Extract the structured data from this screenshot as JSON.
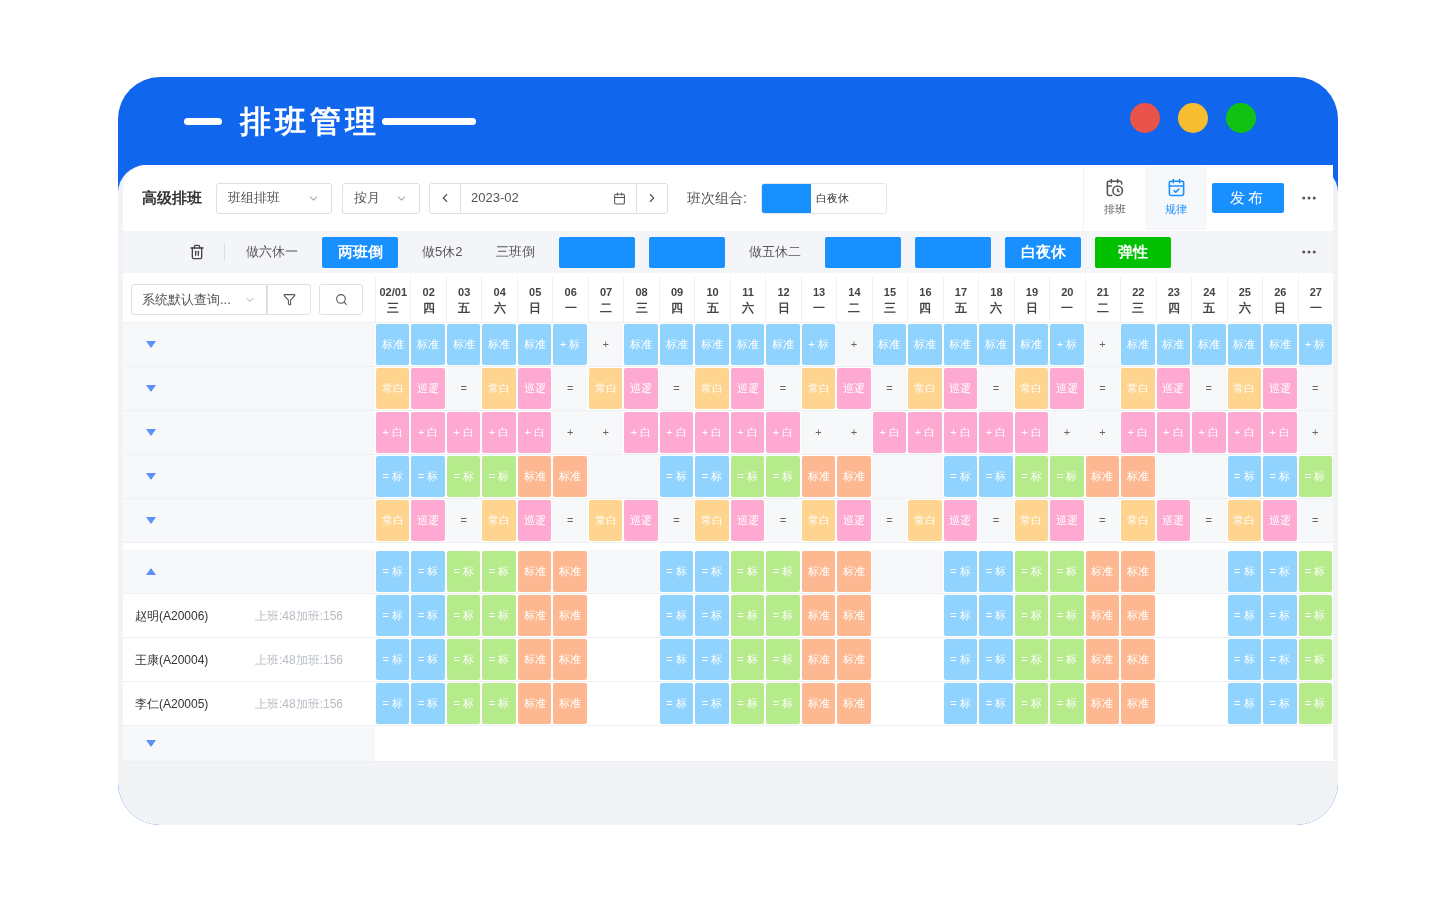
{
  "header": {
    "title": "排班管理",
    "dots": [
      {
        "color": "#e8534a"
      },
      {
        "color": "#f6bd31"
      },
      {
        "color": "#12c212"
      }
    ]
  },
  "toolbar": {
    "title": "高级排班",
    "group_select": "班组排班",
    "period_select": "按月",
    "date": "2023-02",
    "combo_label": "班次组合:",
    "combo_value": "白夜休",
    "actions": [
      {
        "label": "排班",
        "selected": false
      },
      {
        "label": "规律",
        "selected": true
      }
    ],
    "publish": "发布"
  },
  "patterns": [
    {
      "kind": "plain",
      "label": "做六休一"
    },
    {
      "kind": "filled",
      "label": "两班倒",
      "color": "#1890ff"
    },
    {
      "kind": "plain",
      "label": "做5休2"
    },
    {
      "kind": "plain",
      "label": "三班倒"
    },
    {
      "kind": "filled",
      "color": "#1890ff"
    },
    {
      "kind": "filled",
      "color": "#1890ff"
    },
    {
      "kind": "plain",
      "label": "做五休二"
    },
    {
      "kind": "filled",
      "color": "#1890ff"
    },
    {
      "kind": "filled",
      "color": "#1890ff"
    },
    {
      "kind": "filled",
      "label": "白夜休",
      "color": "#1890ff"
    },
    {
      "kind": "filled",
      "label": "弹性",
      "color": "#00c000"
    }
  ],
  "grid": {
    "query_select": "系统默认查询...",
    "days": [
      {
        "date": "02/01",
        "weekday": "三"
      },
      {
        "date": "02",
        "weekday": "四"
      },
      {
        "date": "03",
        "weekday": "五"
      },
      {
        "date": "04",
        "weekday": "六"
      },
      {
        "date": "05",
        "weekday": "日"
      },
      {
        "date": "06",
        "weekday": "一"
      },
      {
        "date": "07",
        "weekday": "二"
      },
      {
        "date": "08",
        "weekday": "三"
      },
      {
        "date": "09",
        "weekday": "四"
      },
      {
        "date": "10",
        "weekday": "五"
      },
      {
        "date": "11",
        "weekday": "六"
      },
      {
        "date": "12",
        "weekday": "日"
      },
      {
        "date": "13",
        "weekday": "一"
      },
      {
        "date": "14",
        "weekday": "二"
      },
      {
        "date": "15",
        "weekday": "三"
      },
      {
        "date": "16",
        "weekday": "四"
      },
      {
        "date": "17",
        "weekday": "五"
      },
      {
        "date": "18",
        "weekday": "六"
      },
      {
        "date": "19",
        "weekday": "日"
      },
      {
        "date": "20",
        "weekday": "一"
      },
      {
        "date": "21",
        "weekday": "二"
      },
      {
        "date": "22",
        "weekday": "三"
      },
      {
        "date": "23",
        "weekday": "四"
      },
      {
        "date": "24",
        "weekday": "五"
      },
      {
        "date": "25",
        "weekday": "六"
      },
      {
        "date": "26",
        "weekday": "日"
      },
      {
        "date": "27",
        "weekday": "一"
      }
    ],
    "rows": [
      {
        "kind": "group",
        "expanded": false,
        "cells": [
          {
            "color": "#8fd3fe",
            "text": "标准"
          },
          {
            "color": "#8fd3fe",
            "text": "标准"
          },
          {
            "color": "#8fd3fe",
            "text": "标准"
          },
          {
            "color": "#8fd3fe",
            "text": "标准"
          },
          {
            "color": "#8fd3fe",
            "text": "标准"
          },
          {
            "color": "#8fd3fe",
            "text": "+ 标"
          },
          {
            "text": "+"
          },
          {
            "color": "#8fd3fe",
            "text": "标准"
          },
          {
            "color": "#8fd3fe",
            "text": "标准"
          },
          {
            "color": "#8fd3fe",
            "text": "标准"
          },
          {
            "color": "#8fd3fe",
            "text": "标准"
          },
          {
            "color": "#8fd3fe",
            "text": "标准"
          },
          {
            "color": "#8fd3fe",
            "text": "+ 标"
          },
          {
            "text": "+"
          },
          {
            "color": "#8fd3fe",
            "text": "标准"
          },
          {
            "color": "#8fd3fe",
            "text": "标准"
          },
          {
            "color": "#8fd3fe",
            "text": "标准"
          },
          {
            "color": "#8fd3fe",
            "text": "标准"
          },
          {
            "color": "#8fd3fe",
            "text": "标准"
          },
          {
            "color": "#8fd3fe",
            "text": "+ 标"
          },
          {
            "text": "+"
          },
          {
            "color": "#8fd3fe",
            "text": "标准"
          },
          {
            "color": "#8fd3fe",
            "text": "标准"
          },
          {
            "color": "#8fd3fe",
            "text": "标准"
          },
          {
            "color": "#8fd3fe",
            "text": "标准"
          },
          {
            "color": "#8fd3fe",
            "text": "标准"
          },
          {
            "color": "#8fd3fe",
            "text": "+ 标"
          }
        ]
      },
      {
        "kind": "group",
        "expanded": false,
        "cells": [
          {
            "color": "#fed48f",
            "text": "常白"
          },
          {
            "color": "#fea9d1",
            "text": "巡逻"
          },
          {
            "text": "="
          },
          {
            "color": "#fed48f",
            "text": "常白"
          },
          {
            "color": "#fea9d1",
            "text": "巡逻"
          },
          {
            "text": "="
          },
          {
            "color": "#fed48f",
            "text": "常白"
          },
          {
            "color": "#fea9d1",
            "text": "巡逻"
          },
          {
            "text": "="
          },
          {
            "color": "#fed48f",
            "text": "常白"
          },
          {
            "color": "#fea9d1",
            "text": "巡逻"
          },
          {
            "text": "="
          },
          {
            "color": "#fed48f",
            "text": "常白"
          },
          {
            "color": "#fea9d1",
            "text": "巡逻"
          },
          {
            "text": "="
          },
          {
            "color": "#fed48f",
            "text": "常白"
          },
          {
            "color": "#fea9d1",
            "text": "巡逻"
          },
          {
            "text": "="
          },
          {
            "color": "#fed48f",
            "text": "常白"
          },
          {
            "color": "#fea9d1",
            "text": "巡逻"
          },
          {
            "text": "="
          },
          {
            "color": "#fed48f",
            "text": "常白"
          },
          {
            "color": "#fea9d1",
            "text": "巡逻"
          },
          {
            "text": "="
          },
          {
            "color": "#fed48f",
            "text": "常白"
          },
          {
            "color": "#fea9d1",
            "text": "巡逻"
          },
          {
            "text": "="
          }
        ]
      },
      {
        "kind": "group",
        "expanded": false,
        "cells": [
          {
            "color": "#fea9d1",
            "text": "+ 白"
          },
          {
            "color": "#fea9d1",
            "text": "+ 白"
          },
          {
            "color": "#fea9d1",
            "text": "+ 白"
          },
          {
            "color": "#fea9d1",
            "text": "+ 白"
          },
          {
            "color": "#fea9d1",
            "text": "+ 白"
          },
          {
            "text": "+"
          },
          {
            "text": "+"
          },
          {
            "color": "#fea9d1",
            "text": "+ 白"
          },
          {
            "color": "#fea9d1",
            "text": "+ 白"
          },
          {
            "color": "#fea9d1",
            "text": "+ 白"
          },
          {
            "color": "#fea9d1",
            "text": "+ 白"
          },
          {
            "color": "#fea9d1",
            "text": "+ 白"
          },
          {
            "text": "+"
          },
          {
            "text": "+"
          },
          {
            "color": "#fea9d1",
            "text": "+ 白"
          },
          {
            "color": "#fea9d1",
            "text": "+ 白"
          },
          {
            "color": "#fea9d1",
            "text": "+ 白"
          },
          {
            "color": "#fea9d1",
            "text": "+ 白"
          },
          {
            "color": "#fea9d1",
            "text": "+ 白"
          },
          {
            "text": "+"
          },
          {
            "text": "+"
          },
          {
            "color": "#fea9d1",
            "text": "+ 白"
          },
          {
            "color": "#fea9d1",
            "text": "+ 白"
          },
          {
            "color": "#fea9d1",
            "text": "+ 白"
          },
          {
            "color": "#fea9d1",
            "text": "+ 白"
          },
          {
            "color": "#fea9d1",
            "text": "+ 白"
          },
          {
            "text": "+"
          }
        ]
      },
      {
        "kind": "group",
        "expanded": false,
        "cells": [
          {
            "color": "#8fd3fe",
            "text": "= 标"
          },
          {
            "color": "#8fd3fe",
            "text": "= 标"
          },
          {
            "color": "#b6eb8b",
            "text": "= 标"
          },
          {
            "color": "#b6eb8b",
            "text": "= 标"
          },
          {
            "color": "#fdb891",
            "text": "标准"
          },
          {
            "color": "#fdb891",
            "text": "标准"
          },
          {},
          {},
          {
            "color": "#8fd3fe",
            "text": "= 标"
          },
          {
            "color": "#8fd3fe",
            "text": "= 标"
          },
          {
            "color": "#b6eb8b",
            "text": "= 标"
          },
          {
            "color": "#b6eb8b",
            "text": "= 标"
          },
          {
            "color": "#fdb891",
            "text": "标准"
          },
          {
            "color": "#fdb891",
            "text": "标准"
          },
          {},
          {},
          {
            "color": "#8fd3fe",
            "text": "= 标"
          },
          {
            "color": "#8fd3fe",
            "text": "= 标"
          },
          {
            "color": "#b6eb8b",
            "text": "= 标"
          },
          {
            "color": "#b6eb8b",
            "text": "= 标"
          },
          {
            "color": "#fdb891",
            "text": "标准"
          },
          {
            "color": "#fdb891",
            "text": "标准"
          },
          {},
          {},
          {
            "color": "#8fd3fe",
            "text": "= 标"
          },
          {
            "color": "#8fd3fe",
            "text": "= 标"
          },
          {
            "color": "#b6eb8b",
            "text": "= 标"
          }
        ]
      },
      {
        "kind": "group",
        "expanded": false,
        "cells": [
          {
            "color": "#fed48f",
            "text": "常白"
          },
          {
            "color": "#fea9d1",
            "text": "巡逻"
          },
          {
            "text": "="
          },
          {
            "color": "#fed48f",
            "text": "常白"
          },
          {
            "color": "#fea9d1",
            "text": "巡逻"
          },
          {
            "text": "="
          },
          {
            "color": "#fed48f",
            "text": "常白"
          },
          {
            "color": "#fea9d1",
            "text": "巡逻"
          },
          {
            "text": "="
          },
          {
            "color": "#fed48f",
            "text": "常白"
          },
          {
            "color": "#fea9d1",
            "text": "巡逻"
          },
          {
            "text": "="
          },
          {
            "color": "#fed48f",
            "text": "常白"
          },
          {
            "color": "#fea9d1",
            "text": "巡逻"
          },
          {
            "text": "="
          },
          {
            "color": "#fed48f",
            "text": "常白"
          },
          {
            "color": "#fea9d1",
            "text": "巡逻"
          },
          {
            "text": "="
          },
          {
            "color": "#fed48f",
            "text": "常白"
          },
          {
            "color": "#fea9d1",
            "text": "巡逻"
          },
          {
            "text": "="
          },
          {
            "color": "#fed48f",
            "text": "常白"
          },
          {
            "color": "#fea9d1",
            "text": "巡逻"
          },
          {
            "text": "="
          },
          {
            "color": "#fed48f",
            "text": "常白"
          },
          {
            "color": "#fea9d1",
            "text": "巡逻"
          },
          {
            "text": "="
          }
        ]
      },
      {
        "kind": "group",
        "expanded": true,
        "cells": [
          {
            "color": "#8fd3fe",
            "text": "= 标"
          },
          {
            "color": "#8fd3fe",
            "text": "= 标"
          },
          {
            "color": "#b6eb8b",
            "text": "= 标"
          },
          {
            "color": "#b6eb8b",
            "text": "= 标"
          },
          {
            "color": "#fdb891",
            "text": "标准"
          },
          {
            "color": "#fdb891",
            "text": "标准"
          },
          {},
          {},
          {
            "color": "#8fd3fe",
            "text": "= 标"
          },
          {
            "color": "#8fd3fe",
            "text": "= 标"
          },
          {
            "color": "#b6eb8b",
            "text": "= 标"
          },
          {
            "color": "#b6eb8b",
            "text": "= 标"
          },
          {
            "color": "#fdb891",
            "text": "标准"
          },
          {
            "color": "#fdb891",
            "text": "标准"
          },
          {},
          {},
          {
            "color": "#8fd3fe",
            "text": "= 标"
          },
          {
            "color": "#8fd3fe",
            "text": "= 标"
          },
          {
            "color": "#b6eb8b",
            "text": "= 标"
          },
          {
            "color": "#b6eb8b",
            "text": "= 标"
          },
          {
            "color": "#fdb891",
            "text": "标准"
          },
          {
            "color": "#fdb891",
            "text": "标准"
          },
          {},
          {},
          {
            "color": "#8fd3fe",
            "text": "= 标"
          },
          {
            "color": "#8fd3fe",
            "text": "= 标"
          },
          {
            "color": "#b6eb8b",
            "text": "= 标"
          }
        ]
      },
      {
        "kind": "employee",
        "name": "赵明(A20006)",
        "stats": "上班:48加班:156",
        "cells": [
          {
            "color": "#8fd3fe",
            "text": "= 标"
          },
          {
            "color": "#8fd3fe",
            "text": "= 标"
          },
          {
            "color": "#b6eb8b",
            "text": "= 标"
          },
          {
            "color": "#b6eb8b",
            "text": "= 标"
          },
          {
            "color": "#fdb891",
            "text": "标准"
          },
          {
            "color": "#fdb891",
            "text": "标准"
          },
          {},
          {},
          {
            "color": "#8fd3fe",
            "text": "= 标"
          },
          {
            "color": "#8fd3fe",
            "text": "= 标"
          },
          {
            "color": "#b6eb8b",
            "text": "= 标"
          },
          {
            "color": "#b6eb8b",
            "text": "= 标"
          },
          {
            "color": "#fdb891",
            "text": "标准"
          },
          {
            "color": "#fdb891",
            "text": "标准"
          },
          {},
          {},
          {
            "color": "#8fd3fe",
            "text": "= 标"
          },
          {
            "color": "#8fd3fe",
            "text": "= 标"
          },
          {
            "color": "#b6eb8b",
            "text": "= 标"
          },
          {
            "color": "#b6eb8b",
            "text": "= 标"
          },
          {
            "color": "#fdb891",
            "text": "标准"
          },
          {
            "color": "#fdb891",
            "text": "标准"
          },
          {},
          {},
          {
            "color": "#8fd3fe",
            "text": "= 标"
          },
          {
            "color": "#8fd3fe",
            "text": "= 标"
          },
          {
            "color": "#b6eb8b",
            "text": "= 标"
          }
        ]
      },
      {
        "kind": "employee",
        "name": "王康(A20004)",
        "stats": "上班:48加班:156",
        "cells": [
          {
            "color": "#8fd3fe",
            "text": "= 标"
          },
          {
            "color": "#8fd3fe",
            "text": "= 标"
          },
          {
            "color": "#b6eb8b",
            "text": "= 标"
          },
          {
            "color": "#b6eb8b",
            "text": "= 标"
          },
          {
            "color": "#fdb891",
            "text": "标准"
          },
          {
            "color": "#fdb891",
            "text": "标准"
          },
          {},
          {},
          {
            "color": "#8fd3fe",
            "text": "= 标"
          },
          {
            "color": "#8fd3fe",
            "text": "= 标"
          },
          {
            "color": "#b6eb8b",
            "text": "= 标"
          },
          {
            "color": "#b6eb8b",
            "text": "= 标"
          },
          {
            "color": "#fdb891",
            "text": "标准"
          },
          {
            "color": "#fdb891",
            "text": "标准"
          },
          {},
          {},
          {
            "color": "#8fd3fe",
            "text": "= 标"
          },
          {
            "color": "#8fd3fe",
            "text": "= 标"
          },
          {
            "color": "#b6eb8b",
            "text": "= 标"
          },
          {
            "color": "#b6eb8b",
            "text": "= 标"
          },
          {
            "color": "#fdb891",
            "text": "标准"
          },
          {
            "color": "#fdb891",
            "text": "标准"
          },
          {},
          {},
          {
            "color": "#8fd3fe",
            "text": "= 标"
          },
          {
            "color": "#8fd3fe",
            "text": "= 标"
          },
          {
            "color": "#b6eb8b",
            "text": "= 标"
          }
        ]
      },
      {
        "kind": "employee",
        "name": "李仁(A20005)",
        "stats": "上班:48加班:156",
        "cells": [
          {
            "color": "#8fd3fe",
            "text": "= 标"
          },
          {
            "color": "#8fd3fe",
            "text": "= 标"
          },
          {
            "color": "#b6eb8b",
            "text": "= 标"
          },
          {
            "color": "#b6eb8b",
            "text": "= 标"
          },
          {
            "color": "#fdb891",
            "text": "标准"
          },
          {
            "color": "#fdb891",
            "text": "标准"
          },
          {},
          {},
          {
            "color": "#8fd3fe",
            "text": "= 标"
          },
          {
            "color": "#8fd3fe",
            "text": "= 标"
          },
          {
            "color": "#b6eb8b",
            "text": "= 标"
          },
          {
            "color": "#b6eb8b",
            "text": "= 标"
          },
          {
            "color": "#fdb891",
            "text": "标准"
          },
          {
            "color": "#fdb891",
            "text": "标准"
          },
          {},
          {},
          {
            "color": "#8fd3fe",
            "text": "= 标"
          },
          {
            "color": "#8fd3fe",
            "text": "= 标"
          },
          {
            "color": "#b6eb8b",
            "text": "= 标"
          },
          {
            "color": "#b6eb8b",
            "text": "= 标"
          },
          {
            "color": "#fdb891",
            "text": "标准"
          },
          {
            "color": "#fdb891",
            "text": "标准"
          },
          {},
          {},
          {
            "color": "#8fd3fe",
            "text": "= 标"
          },
          {
            "color": "#8fd3fe",
            "text": "= 标"
          },
          {
            "color": "#b6eb8b",
            "text": "= 标"
          }
        ]
      },
      {
        "kind": "group",
        "expanded": false
      }
    ]
  }
}
